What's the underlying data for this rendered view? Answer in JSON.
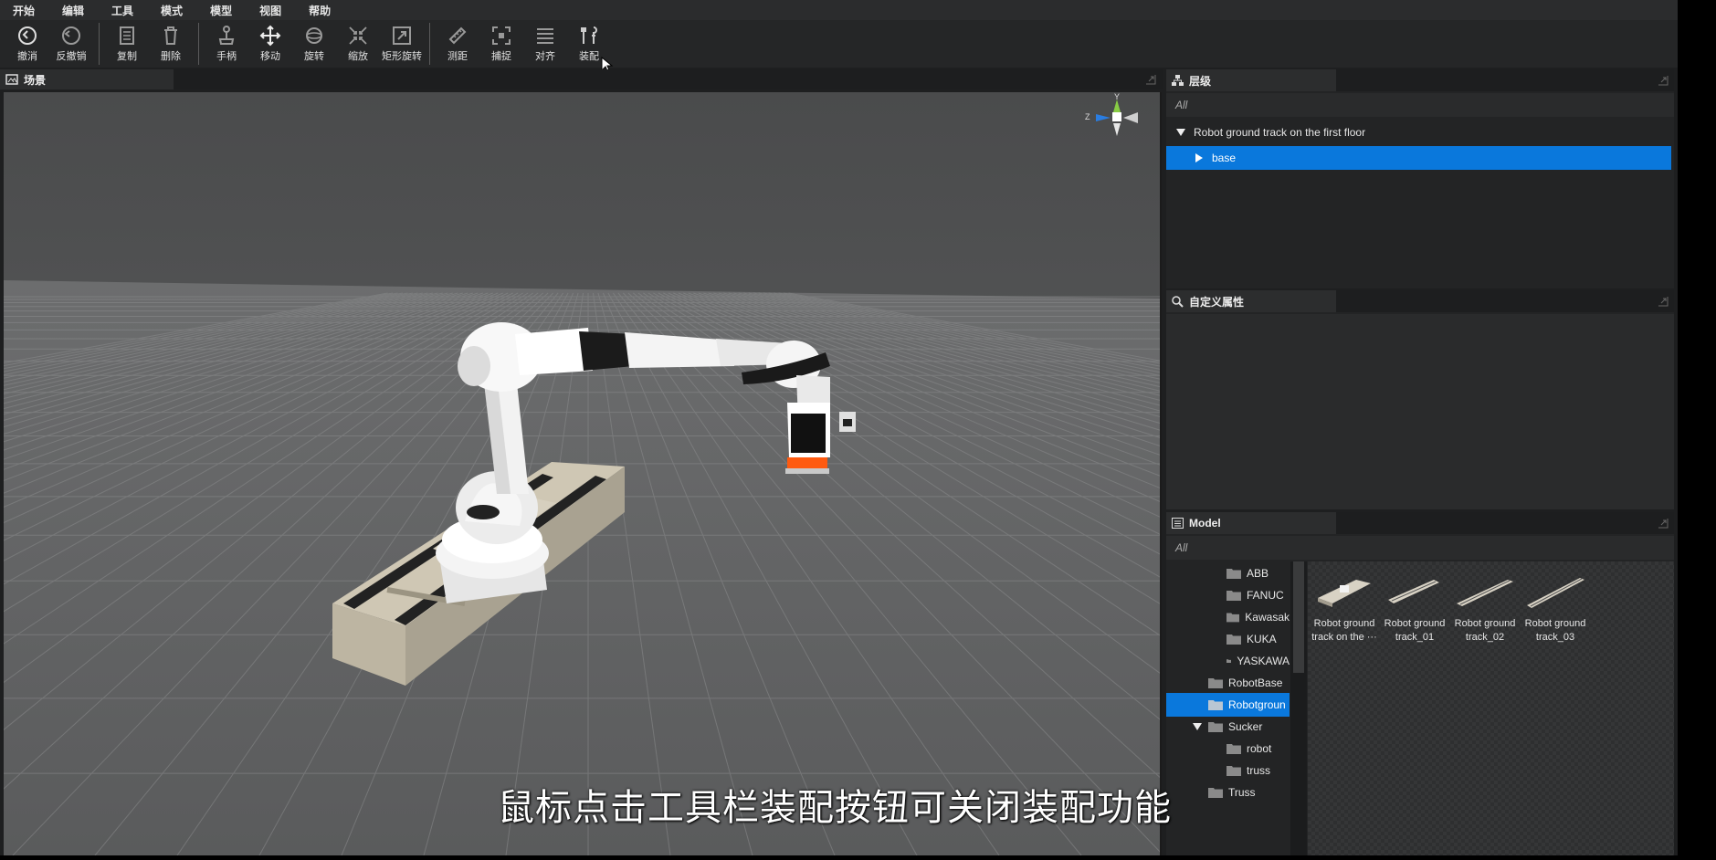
{
  "menu": [
    "开始",
    "编辑",
    "工具",
    "模式",
    "模型",
    "视图",
    "帮助"
  ],
  "toolbar": {
    "undo": "撤消",
    "redo": "反撤销",
    "copy": "复制",
    "delete": "删除",
    "handle": "手柄",
    "move": "移动",
    "rotate": "旋转",
    "scale": "缩放",
    "rect_rotate": "矩形旋转",
    "measure": "测距",
    "snap": "捕捉",
    "align": "对齐",
    "assemble": "装配"
  },
  "scene": {
    "title": "场景",
    "axis_y": "Y",
    "axis_z": "Z"
  },
  "hierarchy": {
    "title": "层级",
    "filter": "All",
    "root": "Robot ground track on the first floor",
    "child": "base"
  },
  "custom_props": {
    "title": "自定义属性"
  },
  "model": {
    "title": "Model",
    "filter": "All",
    "tree": [
      {
        "label": "ABB"
      },
      {
        "label": "FANUC"
      },
      {
        "label": "Kawasak"
      },
      {
        "label": "KUKA"
      },
      {
        "label": "YASKAWA"
      },
      {
        "label": "RobotBase"
      },
      {
        "label": "Robotgroun"
      },
      {
        "label": "Sucker"
      },
      {
        "label": "robot"
      },
      {
        "label": "truss"
      },
      {
        "label": "Truss"
      }
    ],
    "thumbs": [
      {
        "line1": "Robot ground",
        "line2": "track on the ···"
      },
      {
        "line1": "Robot ground",
        "line2": "track_01"
      },
      {
        "line1": "Robot ground",
        "line2": "track_02"
      },
      {
        "line1": "Robot ground",
        "line2": "track_03"
      }
    ]
  },
  "caption": "鼠标点击工具栏装配按钮可关闭装配功能",
  "colors": {
    "selection": "#0a78dc",
    "robot": "#f2f2f2",
    "accent_orange": "#ff5a10"
  }
}
